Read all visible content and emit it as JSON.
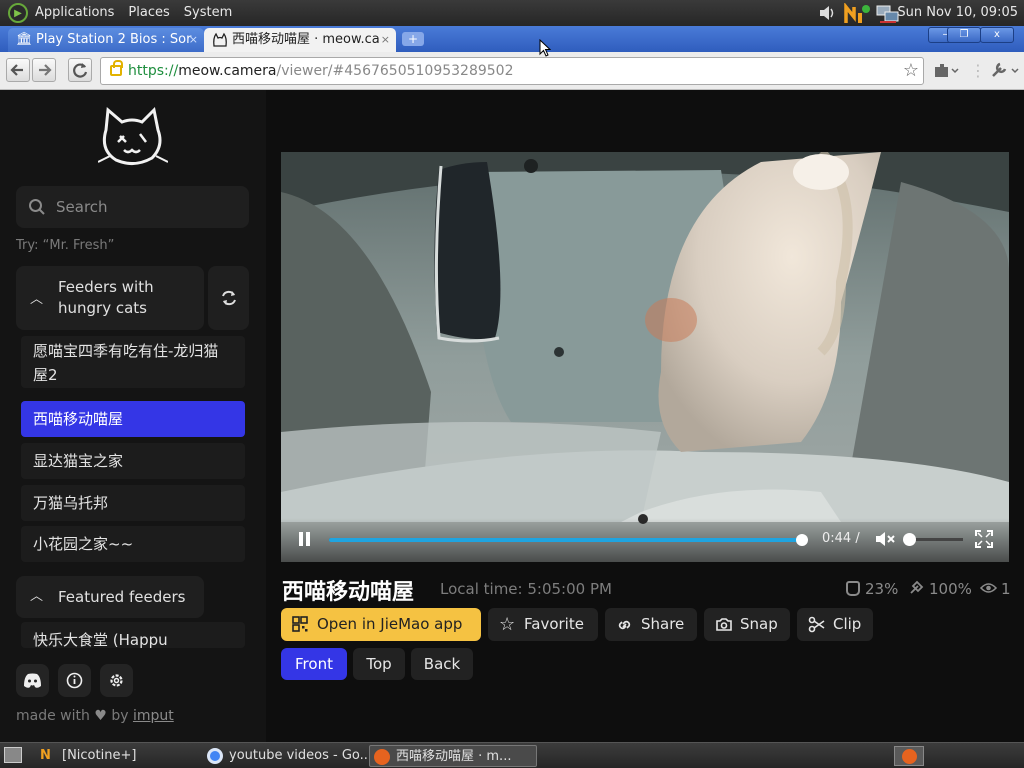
{
  "top_panel": {
    "menus": [
      "Applications",
      "Places",
      "System"
    ],
    "clock": "Sun Nov 10, 09:05"
  },
  "tabs": [
    {
      "title": "Play Station 2 Bios : Sor",
      "icon": "museum-icon",
      "close": "×"
    },
    {
      "title": "西喵移动喵屋 · meow.ca",
      "icon": "cat-icon",
      "close": "×"
    }
  ],
  "window_buttons": [
    "–",
    "❐",
    "x"
  ],
  "toolbar": {
    "url_scheme": "https://",
    "url_host": "meow.camera",
    "url_path": "/viewer/#4567650510953289502"
  },
  "sidebar": {
    "search_placeholder": "Search",
    "search_hint": "Try: “Mr. Fresh”",
    "groups": [
      {
        "label": "Feeders with hungry cats",
        "label_lines": [
          "Feeders with",
          "hungry cats"
        ],
        "items": [
          "愿喵宝四季有吃有住-龙归猫",
          "屋2",
          "西喵移动喵屋",
          "显达猫宝之家",
          "万猫乌托邦",
          "小花园之家~~"
        ]
      },
      {
        "label": "Featured feeders",
        "items": [
          "快乐大食堂 (Happu"
        ]
      }
    ],
    "footer_made_with": "made with",
    "footer_by": "by",
    "footer_link": "imput"
  },
  "player": {
    "time": "0:44 /",
    "progress_fraction": 0.99,
    "volume_fraction": 0.0,
    "muted": true
  },
  "feeder": {
    "title": "西喵移动喵屋",
    "local_time": "Local time: 5:05:00 PM",
    "stats": [
      {
        "icon": "bowl-icon",
        "value": "23%"
      },
      {
        "icon": "food-icon",
        "value": "100%"
      },
      {
        "icon": "eye-icon",
        "value": "1"
      }
    ]
  },
  "actions": {
    "open_app": "Open in JieMao app",
    "favorite": "Favorite",
    "share": "Share",
    "snap": "Snap",
    "clip": "Clip"
  },
  "cameras": {
    "front": "Front",
    "top": "Top",
    "back": "Back",
    "selected": "Front"
  },
  "taskbar": {
    "tasks": [
      "[Nicotine+]",
      "youtube videos - Go...",
      "西喵移动喵屋 · m..."
    ]
  },
  "colors": {
    "accent": "#3436e6",
    "app_button": "#f5c242",
    "progress": "#1fa4e0"
  }
}
